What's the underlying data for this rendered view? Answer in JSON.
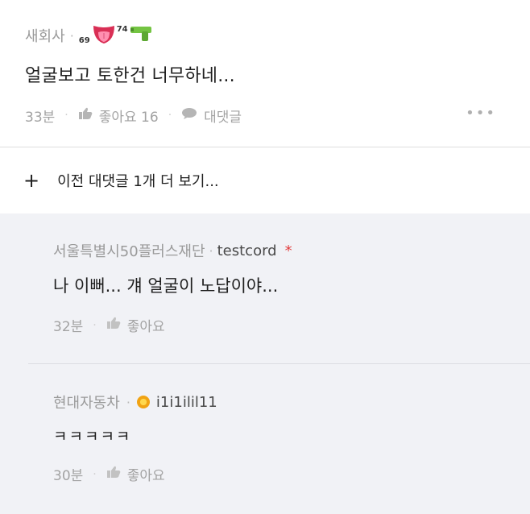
{
  "comment": {
    "company": "새회사",
    "badge_left_num": "69",
    "badge_right_num": "74",
    "text": "얼굴보고 토한건 너무하네...",
    "time": "33분",
    "like_label": "좋아요 16",
    "reply_label": "대댓글",
    "more_icon": "more-dots-icon"
  },
  "previous_replies": {
    "plus": "+",
    "label": "이전 대댓글 1개 더 보기..."
  },
  "replies": [
    {
      "company": "서울특별시50플러스재단",
      "nickname": "testcord",
      "star": "*",
      "text": "나 이뻐... 걔 얼굴이 노답이야...",
      "time": "32분",
      "like_label": "좋아요"
    },
    {
      "company": "현대자동차",
      "nickname": "i1i1ilil11",
      "text": "ㅋㅋㅋㅋㅋ",
      "time": "30분",
      "like_label": "좋아요"
    }
  ],
  "colors": {
    "reply_bg": "#f1f2f6",
    "star": "#e23e3e",
    "muted": "#9a9a9a"
  }
}
